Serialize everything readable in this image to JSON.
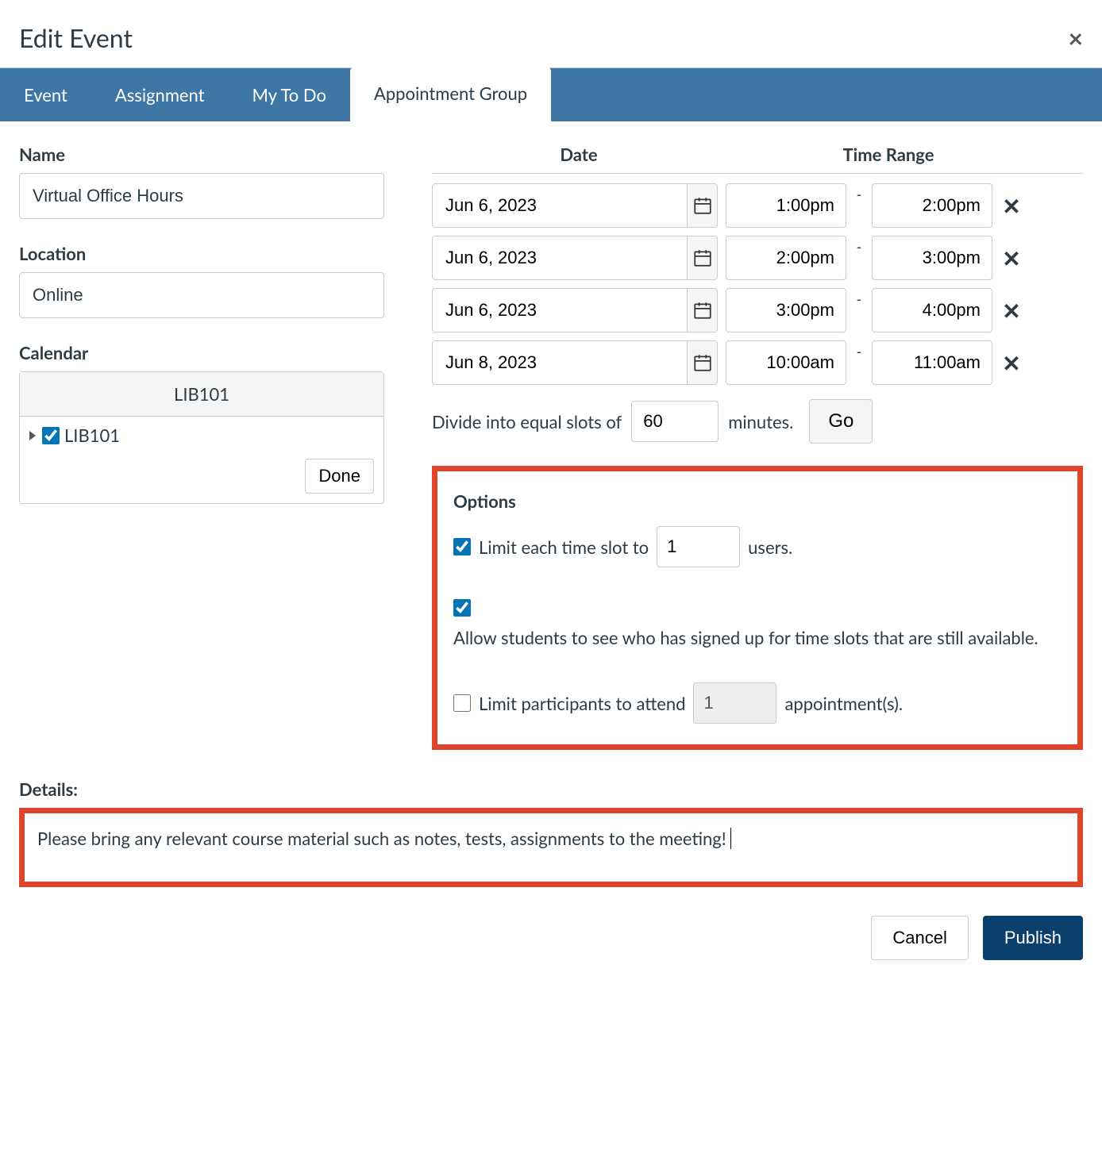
{
  "header": {
    "title": "Edit Event"
  },
  "tabs": {
    "event": "Event",
    "assignment": "Assignment",
    "todo": "My To Do",
    "appointment": "Appointment Group"
  },
  "left": {
    "name_label": "Name",
    "name_value": "Virtual Office Hours",
    "location_label": "Location",
    "location_value": "Online",
    "calendar_label": "Calendar",
    "calendar_header": "LIB101",
    "calendar_item": "LIB101",
    "done": "Done"
  },
  "dt": {
    "date_header": "Date",
    "time_header": "Time Range",
    "rows": [
      {
        "date": "Jun 6, 2023",
        "start": "1:00pm",
        "end": "2:00pm"
      },
      {
        "date": "Jun 6, 2023",
        "start": "2:00pm",
        "end": "3:00pm"
      },
      {
        "date": "Jun 6, 2023",
        "start": "3:00pm",
        "end": "4:00pm"
      },
      {
        "date": "Jun 8, 2023",
        "start": "10:00am",
        "end": "11:00am"
      }
    ],
    "divide_pre": "Divide into equal slots of",
    "divide_value": "60",
    "divide_post": "minutes.",
    "go": "Go"
  },
  "options": {
    "heading": "Options",
    "limit_slot_pre": "Limit each time slot to",
    "limit_slot_value": "1",
    "limit_slot_post": "users.",
    "allow_see": "Allow students to see who has signed up for time slots that are still available.",
    "limit_part_pre": "Limit participants to attend",
    "limit_part_value": "1",
    "limit_part_post": "appointment(s)."
  },
  "details": {
    "label": "Details:",
    "text": "Please bring any relevant course material such as notes, tests, assignments to the meeting!"
  },
  "footer": {
    "cancel": "Cancel",
    "publish": "Publish"
  }
}
